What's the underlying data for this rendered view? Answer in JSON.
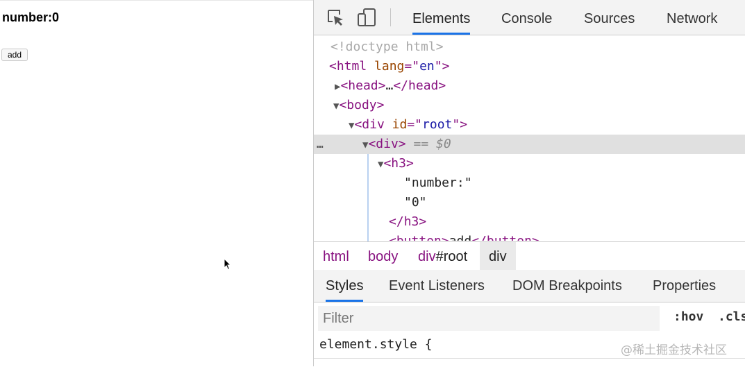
{
  "page": {
    "heading": "number:0",
    "button_label": "add"
  },
  "devtools": {
    "tabs": [
      "Elements",
      "Console",
      "Sources",
      "Network"
    ],
    "active_tab": "Elements",
    "dom": {
      "doctype": "<!doctype html>",
      "html_tag": "html",
      "lang_attr": "lang",
      "lang_val": "en",
      "head_tag": "head",
      "head_collapsed": "…",
      "body_tag": "body",
      "div_tag": "div",
      "id_attr": "id",
      "id_val": "root",
      "selected_marker": " == $0",
      "h3_tag": "h3",
      "text1": "\"number:\"",
      "text2": "\"0\"",
      "button_tag": "button",
      "button_text": "add",
      "dots": "…"
    },
    "breadcrumbs": [
      "html",
      "body",
      "div",
      "#root",
      "div"
    ],
    "subtabs": [
      "Styles",
      "Event Listeners",
      "DOM Breakpoints",
      "Properties"
    ],
    "filter": {
      "placeholder": "Filter"
    },
    "hov": ":hov",
    "cls": ".cls",
    "element_style": "element.style {",
    "watermark": "@稀土掘金技术社区"
  }
}
